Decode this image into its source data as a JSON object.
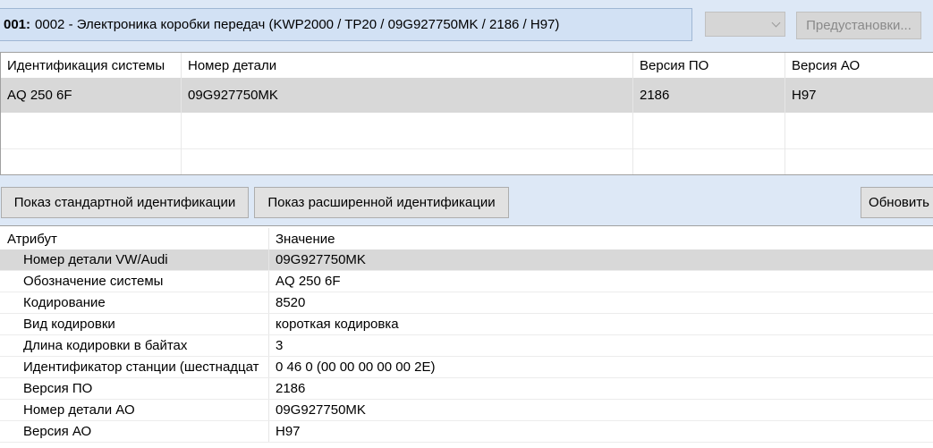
{
  "header": {
    "number": "001:",
    "title": "0002 - Электроника коробки передач  (KWP2000 / TP20 / 09G927750MK  / 2186 / H97)",
    "combo_value": "",
    "preset_button": "Предустановки..."
  },
  "system_table": {
    "columns": [
      "Идентификация системы",
      "Номер детали",
      "Версия ПО",
      "Версия АО"
    ],
    "rows": [
      [
        "AQ 250 6F",
        "09G927750MK",
        "2186",
        "H97"
      ]
    ]
  },
  "buttons": {
    "standard_id": "Показ стандартной идентификации",
    "extended_id": "Показ расширенной идентификации",
    "refresh": "Обновить"
  },
  "attributes": {
    "columns": [
      "Атрибут",
      "Значение"
    ],
    "rows": [
      {
        "attr": "Номер детали VW/Audi",
        "value": "09G927750MK"
      },
      {
        "attr": "Обозначение системы",
        "value": "AQ 250 6F"
      },
      {
        "attr": "Кодирование",
        "value": "8520"
      },
      {
        "attr": "Вид кодировки",
        "value": "короткая кодировка"
      },
      {
        "attr": "Длина кодировки в байтах",
        "value": "3"
      },
      {
        "attr": "Идентификатор станции (шестнадцат",
        "value": "0 46 0 (00 00 00 00 00 2E)"
      },
      {
        "attr": "Версия ПО",
        "value": "2186"
      },
      {
        "attr": "Номер детали АО",
        "value": "09G927750MK"
      },
      {
        "attr": "Версия АО",
        "value": "H97"
      }
    ]
  }
}
